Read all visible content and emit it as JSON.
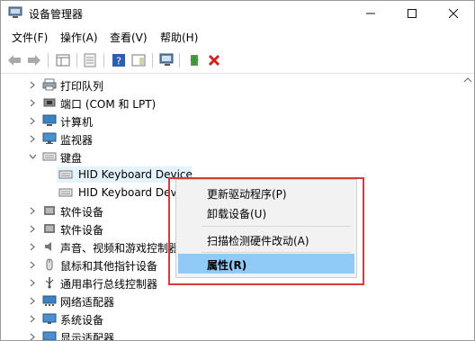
{
  "window": {
    "title": "设备管理器"
  },
  "menu": [
    "文件(F)",
    "操作(A)",
    "查看(V)",
    "帮助(H)"
  ],
  "tree": [
    {
      "label": "打印队列",
      "icon": "printer-queue-icon",
      "expanded": false
    },
    {
      "label": "端口 (COM 和 LPT)",
      "icon": "port-icon",
      "expanded": false
    },
    {
      "label": "计算机",
      "icon": "computer-icon",
      "expanded": false
    },
    {
      "label": "监视器",
      "icon": "monitor-icon",
      "expanded": false
    },
    {
      "label": "键盘",
      "icon": "keyboard-icon",
      "expanded": true
    },
    {
      "label": "HID Keyboard Device",
      "icon": "keyboard-device-icon",
      "child": true,
      "selected": true
    },
    {
      "label": "HID Keyboard Dev",
      "icon": "keyboard-device-icon",
      "child": true
    },
    {
      "label": "软件设备",
      "icon": "software-device-icon",
      "expanded": false
    },
    {
      "label": "软件设备",
      "icon": "software-device-icon",
      "expanded": false
    },
    {
      "label": "声音、视频和游戏控制器",
      "icon": "sound-icon",
      "expanded": false
    },
    {
      "label": "鼠标和其他指针设备",
      "icon": "mouse-icon",
      "expanded": false
    },
    {
      "label": "通用串行总线控制器",
      "icon": "usb-icon",
      "expanded": false
    },
    {
      "label": "网络适配器",
      "icon": "network-adapter-icon",
      "expanded": false
    },
    {
      "label": "系统设备",
      "icon": "system-device-icon",
      "expanded": false
    },
    {
      "label": "显示适配器",
      "icon": "display-adapter-icon",
      "expanded": false
    }
  ],
  "context_menu": {
    "items": [
      {
        "label": "更新驱动程序(P)"
      },
      {
        "label": "卸载设备(U)"
      },
      {
        "label": "扫描检测硬件改动(A)"
      },
      {
        "label": "属性(R)",
        "active": true
      }
    ],
    "highlight_color": "#91c9f7",
    "frame_color": "#d63a3a"
  }
}
